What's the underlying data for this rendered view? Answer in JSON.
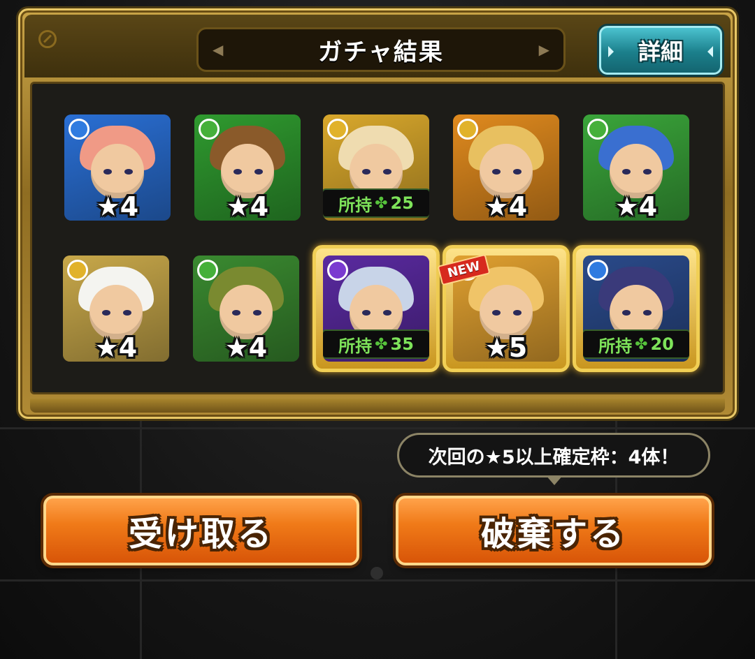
{
  "header": {
    "title": "ガチャ結果",
    "prev_arrow": "◀",
    "next_arrow": "▶",
    "detail_label": "詳細"
  },
  "cards": [
    {
      "attr": "water",
      "attr_color": "#2f7be0",
      "bg": "#2a6fd4",
      "hair": "#f09a86",
      "rarity": "★4",
      "owned": null,
      "owned_count": null,
      "frame": false,
      "new": false
    },
    {
      "attr": "wood",
      "attr_color": "#45b03a",
      "bg": "#2f9a2f",
      "hair": "#8a5a2a",
      "rarity": "★4",
      "owned": null,
      "owned_count": null,
      "frame": false,
      "new": false
    },
    {
      "attr": "light",
      "attr_color": "#e1b22a",
      "bg": "#d9a82c",
      "hair": "#efdcb0",
      "rarity": null,
      "owned": "所持",
      "owned_count": "25",
      "frame": false,
      "new": false
    },
    {
      "attr": "light",
      "attr_color": "#e1b22a",
      "bg": "#e08a1e",
      "hair": "#e8c060",
      "rarity": "★4",
      "owned": null,
      "owned_count": null,
      "frame": false,
      "new": false
    },
    {
      "attr": "wood",
      "attr_color": "#45b03a",
      "bg": "#3aa53a",
      "hair": "#3a6fd0",
      "rarity": "★4",
      "owned": null,
      "owned_count": null,
      "frame": false,
      "new": false
    },
    {
      "attr": "light",
      "attr_color": "#e1b22a",
      "bg": "#c8a84a",
      "hair": "#f4f4f0",
      "rarity": "★4",
      "owned": null,
      "owned_count": null,
      "frame": false,
      "new": false
    },
    {
      "attr": "wood",
      "attr_color": "#45b03a",
      "bg": "#3a8a30",
      "hair": "#7a8a30",
      "rarity": "★4",
      "owned": null,
      "owned_count": null,
      "frame": false,
      "new": false
    },
    {
      "attr": "dark",
      "attr_color": "#7a3ad0",
      "bg": "#5a2aa0",
      "hair": "#c8d4e8",
      "rarity": null,
      "owned": "所持",
      "owned_count": "35",
      "frame": true,
      "new": false
    },
    {
      "attr": "light",
      "attr_color": "#e1b22a",
      "bg": "#e0a030",
      "hair": "#f0c468",
      "rarity": "★5",
      "owned": null,
      "owned_count": null,
      "frame": true,
      "new": true
    },
    {
      "attr": "water",
      "attr_color": "#2f7be0",
      "bg": "#2a4a8a",
      "hair": "#3a3a7a",
      "rarity": null,
      "owned": "所持",
      "owned_count": "20",
      "frame": true,
      "new": false
    }
  ],
  "new_badge": "NEW",
  "clover_glyph": "✤",
  "notice": "次回の★5以上確定枠：4体！",
  "buttons": {
    "receive": "受け取る",
    "discard": "破棄する"
  }
}
